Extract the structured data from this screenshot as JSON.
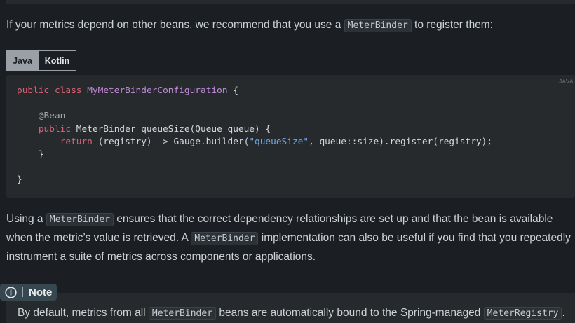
{
  "intro": {
    "before": "If your metrics depend on other beans, we recommend that you use a ",
    "code": "MeterBinder",
    "after": " to register them:"
  },
  "tabs": [
    {
      "label": "Java",
      "active": true
    },
    {
      "label": "Kotlin",
      "active": false
    }
  ],
  "code_block": {
    "lang_tag": "JAVA"
  },
  "para2": {
    "p1": "Using a ",
    "c1": "MeterBinder",
    "p2": " ensures that the correct dependency relationships are set up and that the bean is available when the metric’s value is retrieved. A ",
    "c2": "MeterBinder",
    "p3": " implementation can also be useful if you find that you repeatedly instrument a suite of metrics across components or applications."
  },
  "note": {
    "title": "Note",
    "icon": "info-circle-icon",
    "t1": "By default, metrics from all ",
    "c1": "MeterBinder",
    "t2": " beans are automatically bound to the Spring-managed ",
    "c2": "MeterRegistry",
    "t3": "."
  }
}
